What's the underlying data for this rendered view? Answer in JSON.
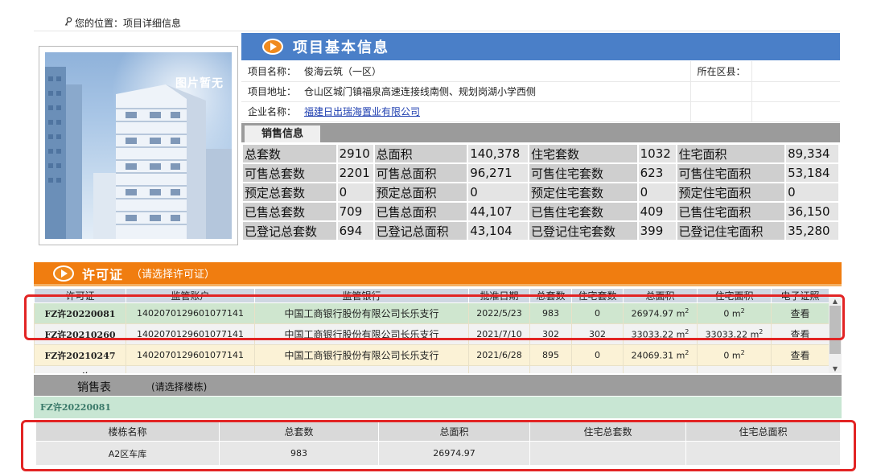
{
  "breadcrumb": {
    "icon": "key-icon",
    "text": "您的位置：项目详细信息"
  },
  "photo": {
    "placeholder_text": "图片暂无"
  },
  "basic_info": {
    "section_title": "项目基本信息",
    "rows": [
      {
        "label": "项目名称：",
        "value": "俊海云筑（一区）",
        "right_label": "所在区县：",
        "right_value": ""
      },
      {
        "label": "项目地址：",
        "value": "仓山区城门镇福泉高速连接线南侧、规划岗湖小学西侧",
        "right_label": "",
        "right_value": ""
      },
      {
        "label": "企业名称：",
        "value": "福建日出瑞海置业有限公司",
        "right_label": "",
        "right_value": ""
      }
    ]
  },
  "sales_info": {
    "tab_label": "销售信息",
    "rows": [
      [
        "总套数",
        "2910",
        "总面积",
        "140,378",
        "住宅套数",
        "1032",
        "住宅面积",
        "89,334"
      ],
      [
        "可售总套数",
        "2201",
        "可售总面积",
        "96,271",
        "可售住宅套数",
        "623",
        "可售住宅面积",
        "53,184"
      ],
      [
        "预定总套数",
        "0",
        "预定总面积",
        "0",
        "预定住宅套数",
        "0",
        "预定住宅面积",
        "0"
      ],
      [
        "已售总套数",
        "709",
        "已售总面积",
        "44,107",
        "已售住宅套数",
        "409",
        "已售住宅面积",
        "36,150"
      ],
      [
        "已登记总套数",
        "694",
        "已登记总面积",
        "43,104",
        "已登记住宅套数",
        "399",
        "已登记住宅面积",
        "35,280"
      ]
    ]
  },
  "permits": {
    "title": "许可证",
    "hint": "（请选择许可证）",
    "columns": [
      "许可证",
      "监管账户",
      "监管银行",
      "批准日期",
      "总套数",
      "住宅套数",
      "总面积",
      "住宅面积",
      "电子证照"
    ],
    "rows": [
      {
        "permit": "FZ许20220081",
        "account": "1402070129601077141",
        "bank": "中国工商银行股份有限公司长乐支行",
        "date": "2022/5/23",
        "total_units": "983",
        "res_units": "0",
        "total_area": "26974.97 m",
        "res_area": "0 m",
        "view": "查看"
      },
      {
        "permit": "FZ许20210260",
        "account": "1402070129601077141",
        "bank": "中国工商银行股份有限公司长乐支行",
        "date": "2021/7/10",
        "total_units": "302",
        "res_units": "302",
        "total_area": "33033.22 m",
        "res_area": "33033.22 m",
        "view": "查看"
      },
      {
        "permit": "FZ许20210247",
        "account": "1402070129601077141",
        "bank": "中国工商银行股份有限公司长乐支行",
        "date": "2021/6/28",
        "total_units": "895",
        "res_units": "0",
        "total_area": "24069.31 m",
        "res_area": "0 m",
        "view": "查看"
      },
      {
        "permit": "FZ许",
        "account": "",
        "bank": "",
        "date": "",
        "total_units": "",
        "res_units": "",
        "total_area": "",
        "res_area": "",
        "view": ""
      }
    ],
    "area_sup": "2"
  },
  "sales_table": {
    "label": "销售表",
    "hint": "(请选择楼栋)",
    "selected_permit": "FZ许20220081",
    "columns": [
      "楼栋名称",
      "总套数",
      "总面积",
      "住宅总套数",
      "住宅总面积"
    ],
    "rows": [
      {
        "building": "A2区车库",
        "total_units": "983",
        "total_area": "26974.97",
        "res_units": "",
        "res_area": ""
      }
    ]
  },
  "colors": {
    "header_blue": "#4a7fc8",
    "header_orange": "#f07d10",
    "selected_row": "#cfe6cf",
    "highlight_red": "#e22424"
  }
}
